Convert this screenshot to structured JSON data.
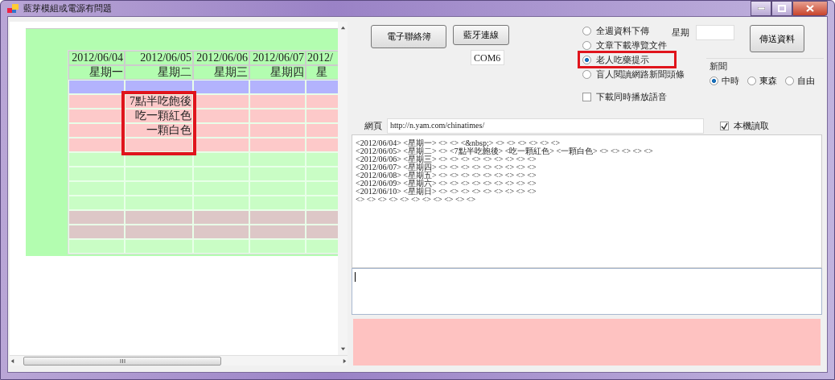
{
  "window": {
    "title": "藍芽模組或電源有問題"
  },
  "schedule": {
    "rows": [
      {
        "color": "#b3b3fd"
      },
      {
        "color": "#fdc9c9"
      },
      {
        "color": "#fdc9c9"
      },
      {
        "color": "#fdc9c9"
      },
      {
        "color": "#fdc9c9"
      },
      {
        "color": "#c9fdc5"
      },
      {
        "color": "#c9fdc5"
      },
      {
        "color": "#c9fdc5"
      },
      {
        "color": "#c9fdc5"
      },
      {
        "color": "#ddc7c7"
      },
      {
        "color": "#ddc7c7"
      },
      {
        "color": "#c9fdc5"
      }
    ],
    "columns": [
      {
        "date": "2012/06/04",
        "weekday": "星期一",
        "highlighted": false
      },
      {
        "date": "2012/06/05",
        "weekday": "星期二",
        "entries": [
          "7點半吃飽後",
          "吃一顆紅色",
          "一顆白色"
        ],
        "highlighted": true
      },
      {
        "date": "2012/06/06",
        "weekday": "星期三",
        "highlighted": false
      },
      {
        "date": "2012/06/07",
        "weekday": "星期四",
        "highlighted": false
      },
      {
        "date": "2012/",
        "weekday": "星",
        "highlighted": false
      }
    ]
  },
  "buttons": {
    "contact_book": "電子聯絡簿",
    "bluetooth": "藍牙連線",
    "send": "傳送資料"
  },
  "port": {
    "value": "COM6"
  },
  "modes": [
    {
      "label": "全週資料下傳",
      "selected": false,
      "highlighted": false
    },
    {
      "label": "文章下載導覽文件",
      "selected": false,
      "highlighted": false
    },
    {
      "label": "老人吃藥提示",
      "selected": true,
      "highlighted": true
    },
    {
      "label": "盲人閱讀網路新聞頭條",
      "selected": false,
      "highlighted": false
    }
  ],
  "weekday_field": {
    "label": "星期"
  },
  "news": {
    "title": "新聞",
    "options": [
      {
        "label": "中時",
        "selected": true
      },
      {
        "label": "東森",
        "selected": false
      },
      {
        "label": "自由",
        "selected": false
      }
    ]
  },
  "play_audio": {
    "label": "下載同時播放語音",
    "checked": false
  },
  "url": {
    "label": "網頁",
    "value": "http://n.yam.com/chinatimes/"
  },
  "local_read": {
    "label": "本機讀取",
    "checked": true
  },
  "output": {
    "lines": [
      "<2012/06/04> <星期一> <> <> <&nbsp;> <> <> <> <> <> <>",
      "<2012/06/05> <星期二> <> <7點半吃飽後> <吃一顆紅色> <一顆白色> <> <> <> <> <>",
      "<2012/06/06> <星期三> <> <> <> <> <> <> <> <> <>",
      "<2012/06/07> <星期四> <> <> <> <> <> <> <> <> <>",
      "<2012/06/08> <星期五> <> <> <> <> <> <> <> <> <>",
      "<2012/06/09> <星期六> <> <> <> <> <> <> <> <> <>",
      "<2012/06/10> <星期日> <> <> <> <> <> <> <> <> <>",
      "<> <> <> <> <> <> <> <> <> <> <>"
    ]
  }
}
